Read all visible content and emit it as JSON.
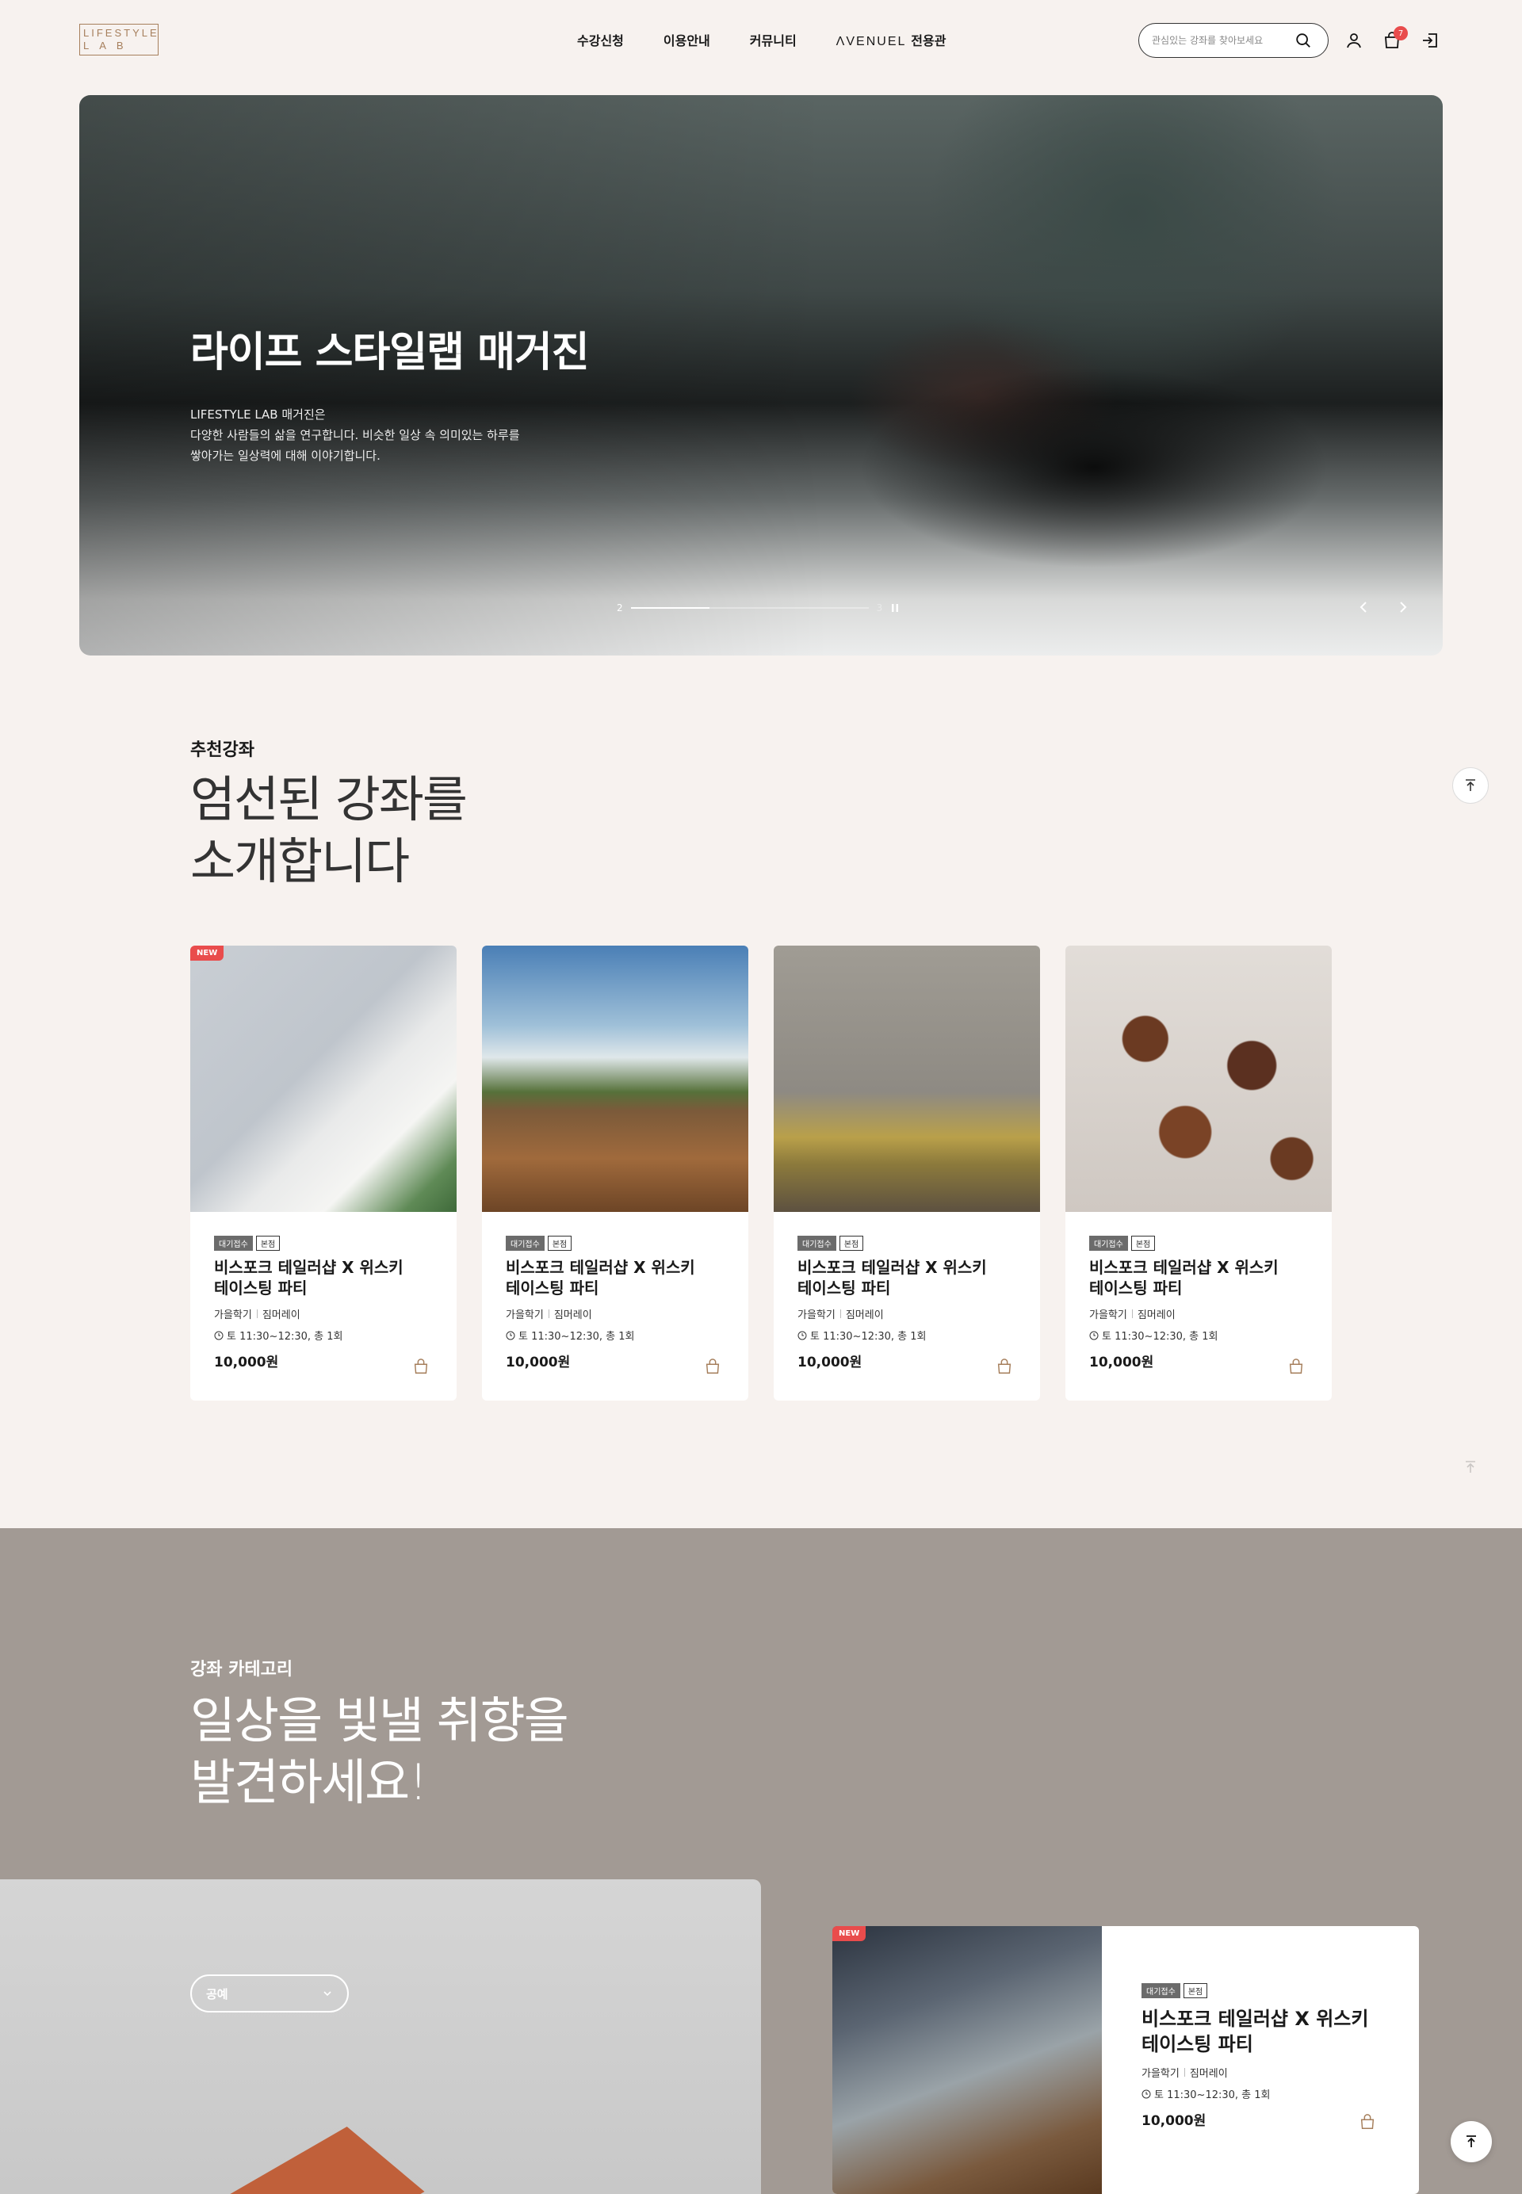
{
  "header": {
    "logo_line1": "LIFESTYLE",
    "logo_line2": "LAB",
    "nav": [
      "수강신청",
      "이용안내",
      "커뮤니티"
    ],
    "nav_brand": "ΛVENUEL",
    "nav_brand_suffix": "전용관",
    "search_placeholder": "관심있는 강좌를 찾아보세요",
    "cart_count": "7"
  },
  "hero": {
    "title": "라이프 스타일랩 매거진",
    "description": "LIFESTYLE LAB 매거진은\n다양한 사람들의 삶을 연구합니다. 비슷한 일상 속 의미있는 하루를\n쌓아가는 일상력에 대해 이야기합니다.",
    "current_slide": "2",
    "total_slides": "3",
    "progress": 0.33
  },
  "recommend": {
    "label": "추천강좌",
    "title": "엄선된 강좌를\n소개합니다",
    "cards": [
      {
        "new": "NEW",
        "tag1": "대기접수",
        "tag2": "본점",
        "title": "비스포크 테일러샵 X 위스키\n테이스팅 파티",
        "term": "가을학기",
        "teacher": "짐머레이",
        "schedule": "토 11:30~12:30, 총 1회",
        "price": "10,000원",
        "image": "book-and-plant"
      },
      {
        "new": "",
        "tag1": "대기접수",
        "tag2": "본점",
        "title": "비스포크 테일러샵 X 위스키\n테이스팅 파티",
        "term": "가을학기",
        "teacher": "짐머레이",
        "schedule": "토 11:30~12:30, 총 1회",
        "price": "10,000원",
        "image": "tennis-player"
      },
      {
        "new": "",
        "tag1": "대기접수",
        "tag2": "본점",
        "title": "비스포크 테일러샵 X 위스키\n테이스팅 파티",
        "term": "가을학기",
        "teacher": "짐머레이",
        "schedule": "토 11:30~12:30, 총 1회",
        "price": "10,000원",
        "image": "yoga-mat"
      },
      {
        "new": "",
        "tag1": "대기접수",
        "tag2": "본점",
        "title": "비스포크 테일러샵 X 위스키\n테이스팅 파티",
        "term": "가을학기",
        "teacher": "짐머레이",
        "schedule": "토 11:30~12:30, 총 1회",
        "price": "10,000원",
        "image": "copper-pans"
      }
    ]
  },
  "category": {
    "label": "강좌 카테고리",
    "title": "일상을 빛낼 취향을\n발견하세요!",
    "select_value": "공예",
    "featured": {
      "new": "NEW",
      "tag1": "대기접수",
      "tag2": "본점",
      "title": "비스포크 테일러샵 X 위스키\n테이스팅 파티",
      "term": "가을학기",
      "teacher": "짐머레이",
      "schedule": "토 11:30~12:30, 총 1회",
      "price": "10,000원",
      "image": "coffee-pour"
    }
  },
  "colors": {
    "accent": "#a67f5c",
    "new_badge": "#e94c4c",
    "page_bg": "#f7f2ef",
    "category_bg": "#a29a94"
  }
}
